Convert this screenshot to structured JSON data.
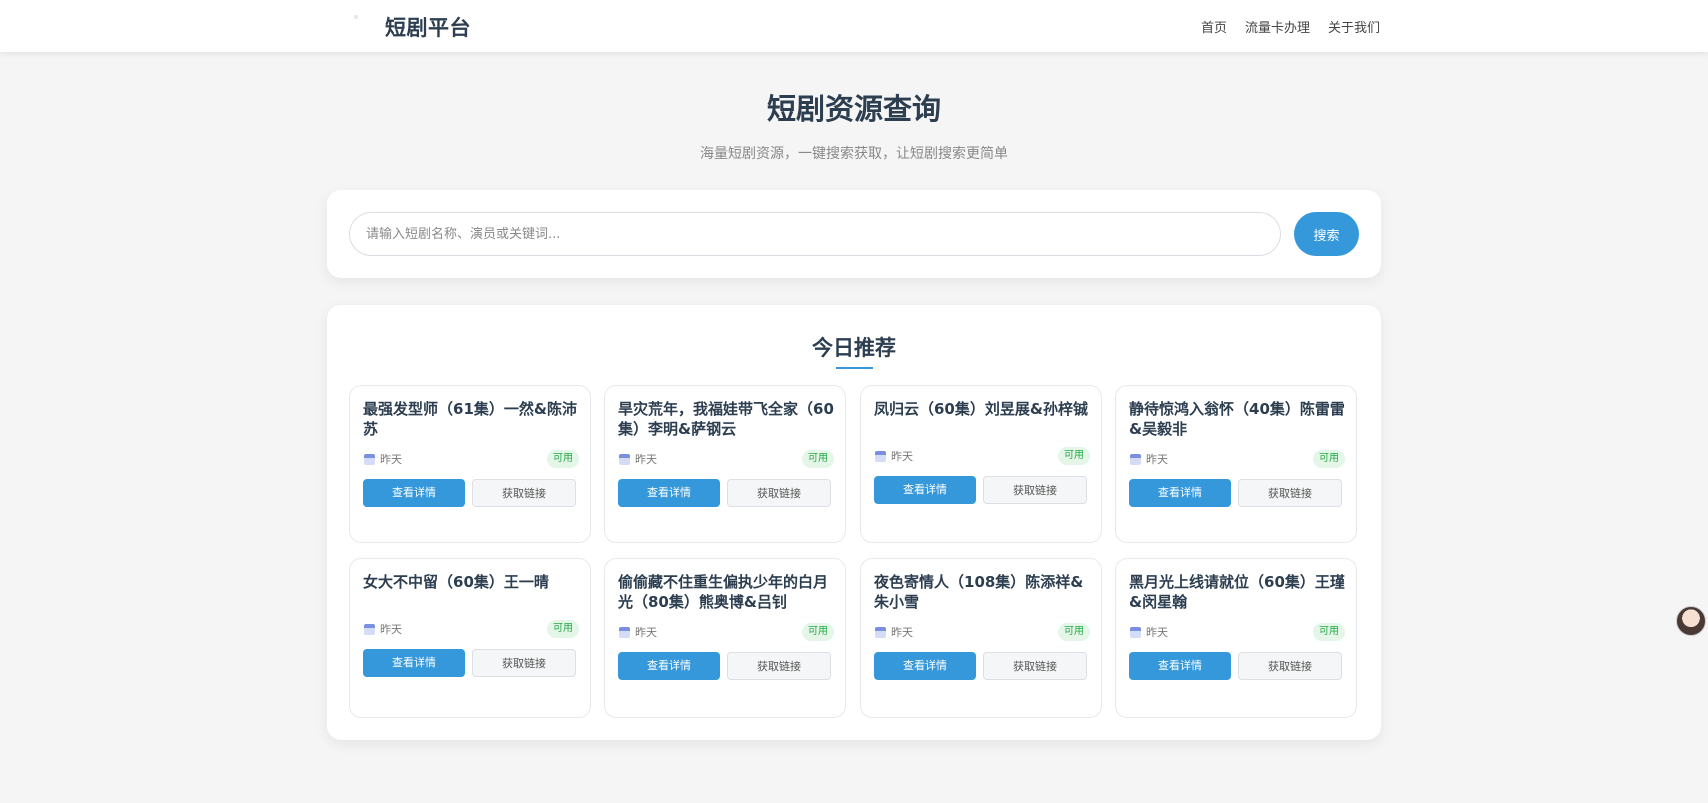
{
  "nav": {
    "brand": "短剧平台",
    "links": [
      "首页",
      "流量卡办理",
      "关于我们"
    ]
  },
  "hero": {
    "title": "短剧资源查询",
    "subtitle": "海量短剧资源，一键搜索获取，让短剧搜索更简单"
  },
  "search": {
    "placeholder": "请输入短剧名称、演员或关键词...",
    "button": "搜索"
  },
  "recommend": {
    "title": "今日推荐",
    "cards": [
      {
        "title": "最强发型师（61集）一然&陈沛苏",
        "date": "昨天",
        "status": "可用",
        "detail": "查看详情",
        "link": "获取链接"
      },
      {
        "title": "旱灾荒年，我福娃带飞全家（60集）李明&萨钢云",
        "date": "昨天",
        "status": "可用",
        "detail": "查看详情",
        "link": "获取链接"
      },
      {
        "title": "凤归云（60集）刘昱展&孙梓铖",
        "date": "昨天",
        "status": "可用",
        "detail": "查看详情",
        "link": "获取链接"
      },
      {
        "title": "静待惊鸿入翁怀（40集）陈雷雷&吴毅非",
        "date": "昨天",
        "status": "可用",
        "detail": "查看详情",
        "link": "获取链接"
      },
      {
        "title": "女大不中留（60集）王一晴",
        "date": "昨天",
        "status": "可用",
        "detail": "查看详情",
        "link": "获取链接"
      },
      {
        "title": "偷偷藏不住重生偏执少年的白月光（80集）熊奥博&吕钊",
        "date": "昨天",
        "status": "可用",
        "detail": "查看详情",
        "link": "获取链接"
      },
      {
        "title": "夜色寄情人（108集）陈添祥&朱小雪",
        "date": "昨天",
        "status": "可用",
        "detail": "查看详情",
        "link": "获取链接"
      },
      {
        "title": "黑月光上线请就位（60集）王瑾&闵星翰",
        "date": "昨天",
        "status": "可用",
        "detail": "查看详情",
        "link": "获取链接"
      }
    ]
  },
  "icons": {
    "card_meta": "calendar-icon",
    "floating": "assistant-avatar-icon"
  },
  "colors": {
    "accent": "#3498db",
    "heading": "#2c3e50",
    "badge_bg": "#e3f6e8",
    "badge_text": "#28a745",
    "page_bg": "#f5f5f5"
  }
}
